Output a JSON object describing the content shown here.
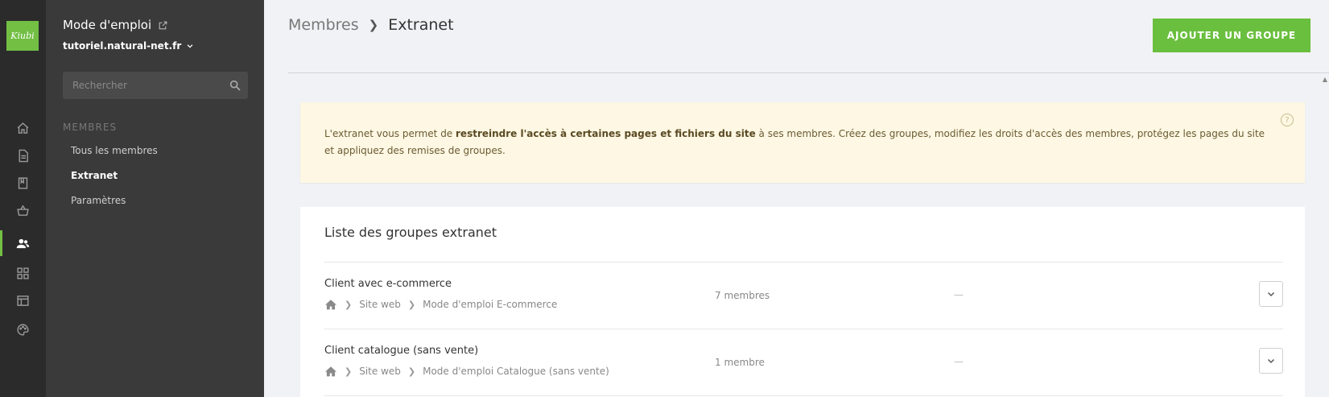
{
  "brand": {
    "logo_text": "Kiubi",
    "accent": "#6abf3e"
  },
  "rail": {
    "icons": [
      "home-icon",
      "page-icon",
      "book-icon",
      "basket-icon",
      "members-icon",
      "modules-icon",
      "layout-icon",
      "palette-icon"
    ],
    "active": "members-icon"
  },
  "sidebar": {
    "site_title": "Mode d'emploi",
    "site_domain": "tutoriel.natural-net.fr",
    "search_placeholder": "Rechercher",
    "section_label": "MEMBRES",
    "items": [
      {
        "label": "Tous les membres",
        "active": false
      },
      {
        "label": "Extranet",
        "active": true
      },
      {
        "label": "Paramètres",
        "active": false
      }
    ]
  },
  "header": {
    "breadcrumb": {
      "parent": "Membres",
      "current": "Extranet"
    },
    "add_button_label": "AJOUTER UN GROUPE"
  },
  "info": {
    "text_before": "L'extranet vous permet de ",
    "text_bold": "restreindre l'accès à certaines pages et fichiers du site",
    "text_after": " à ses membres. Créez des groupes, modifiez les droits d'accès des membres, protégez les pages du site et appliquez des remises de groupes.",
    "help_symbol": "?"
  },
  "groups": {
    "title": "Liste des groupes extranet",
    "rows": [
      {
        "name": "Client avec e-commerce",
        "path": [
          "Site web",
          "Mode d'emploi E-commerce"
        ],
        "count": "7 membres",
        "discount": "—"
      },
      {
        "name": "Client catalogue (sans vente)",
        "path": [
          "Site web",
          "Mode d'emploi Catalogue (sans vente)"
        ],
        "count": "1 membre",
        "discount": "—"
      }
    ]
  }
}
